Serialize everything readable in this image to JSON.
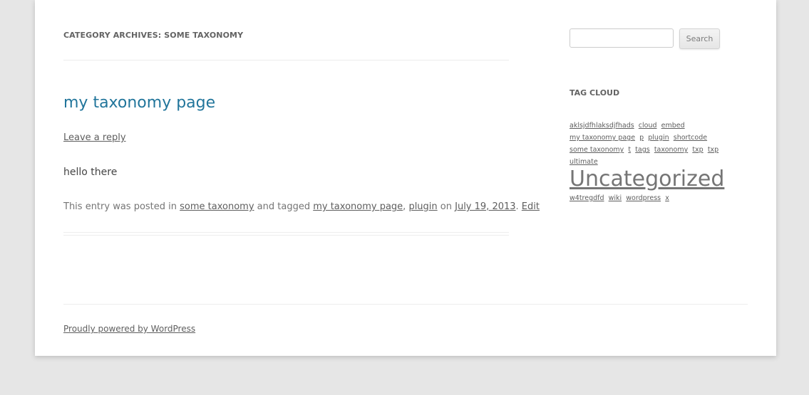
{
  "archive": {
    "title": "Category Archives: some taxonomy"
  },
  "post": {
    "title": "my taxonomy page",
    "leave_reply": "Leave a reply",
    "content": "hello there",
    "meta": {
      "prefix": "This entry was posted in ",
      "category": "some taxonomy",
      "tagged": " and tagged ",
      "tag1": "my taxonomy page",
      "sep": ", ",
      "tag2": "plugin",
      "on": " on ",
      "date": "July 19, 2013",
      "dot": ". ",
      "edit": "Edit"
    }
  },
  "sidebar": {
    "search": {
      "placeholder": "",
      "button_label": "Search"
    },
    "tag_cloud": {
      "title": "Tag Cloud",
      "tags": [
        "aklsjdfhlaksdjfhads",
        "cloud",
        "embed",
        "my taxonomy page",
        "p",
        "plugin",
        "shortcode",
        "some taxonomy",
        "t",
        "tags",
        "taxonomy",
        "txp",
        "txp",
        "ultimate",
        "Uncategorized",
        "w4tregdfd",
        "wiki",
        "wordpress",
        "x"
      ]
    }
  },
  "footer": {
    "credit": "Proudly powered by WordPress"
  }
}
